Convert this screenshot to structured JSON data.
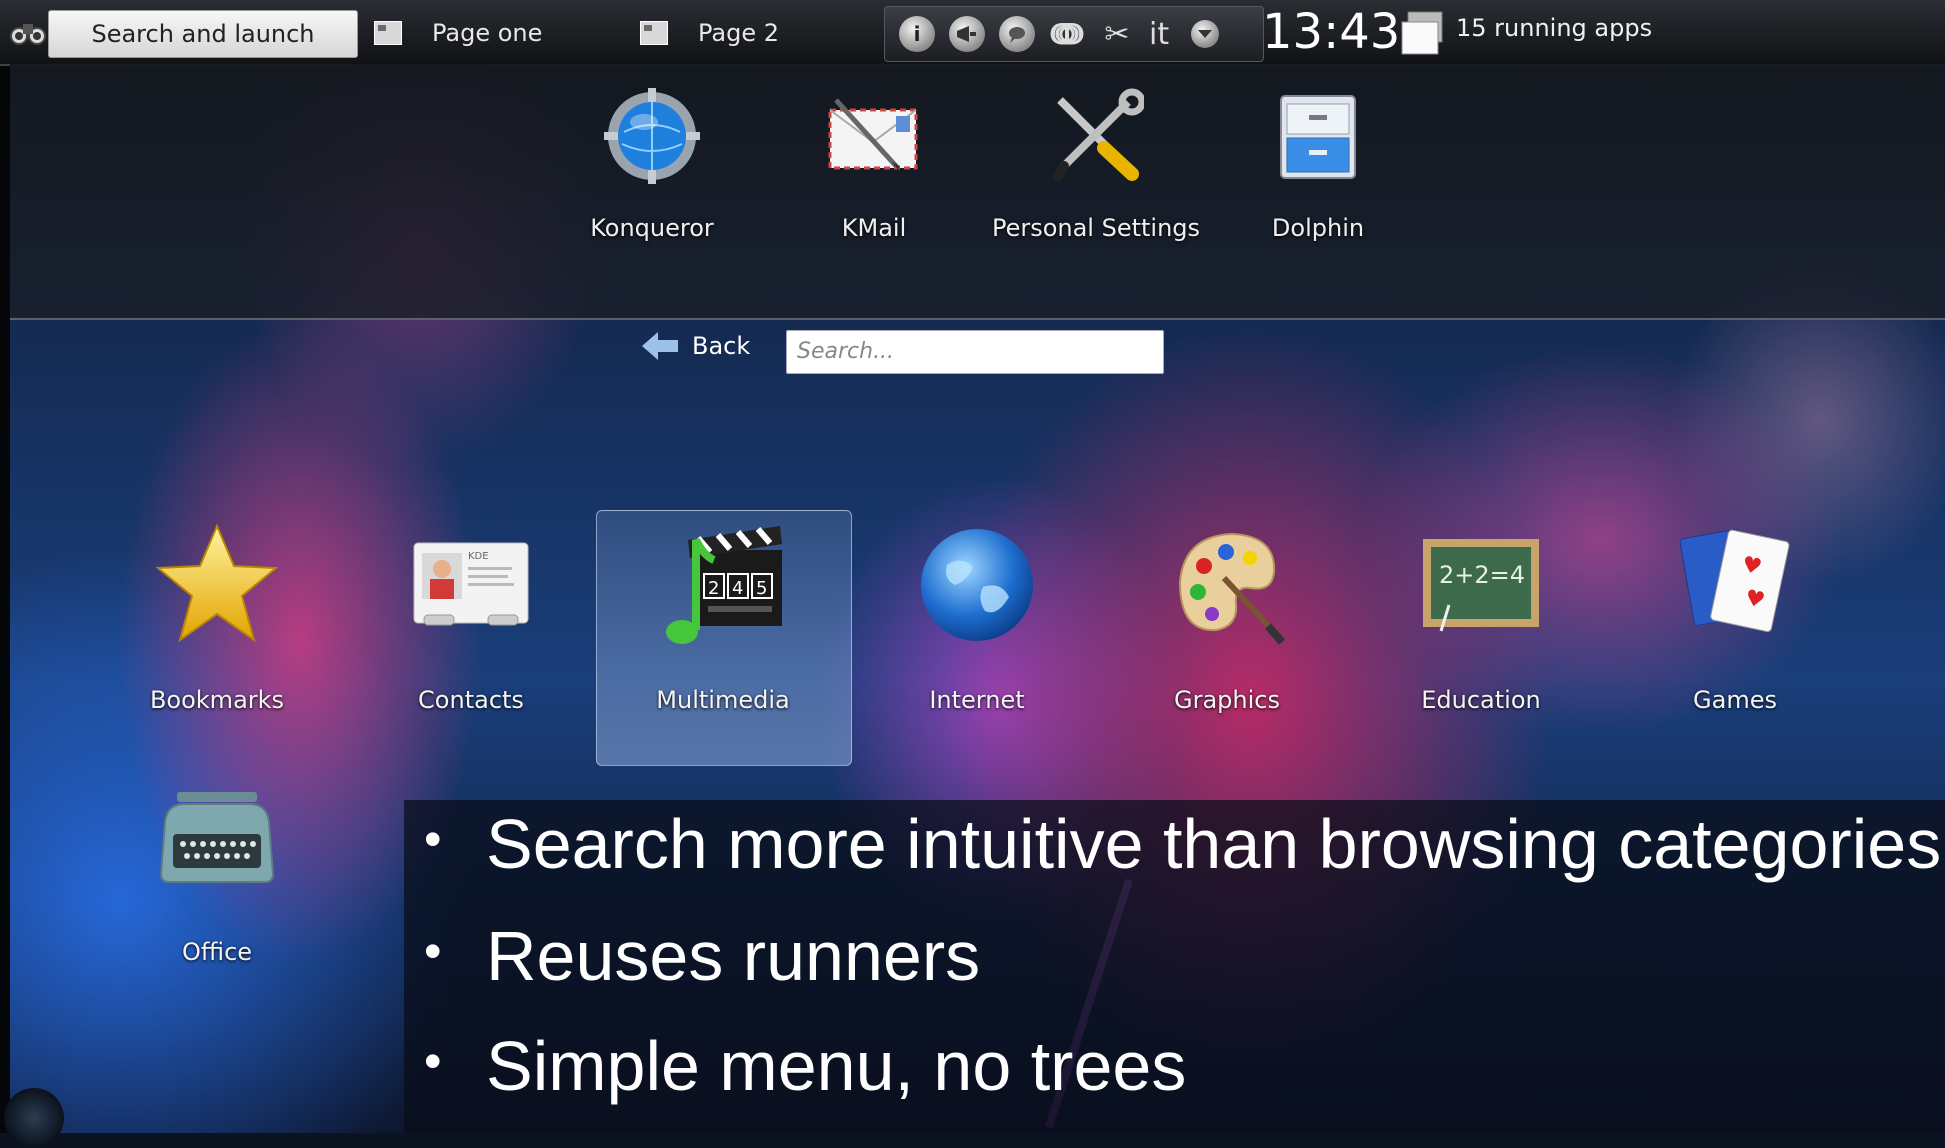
{
  "panel": {
    "launcher_label": "Search and launch",
    "pages": [
      {
        "label": "Page one"
      },
      {
        "label": "Page 2"
      }
    ],
    "tray": {
      "info_icon_char": "i",
      "keyboard_layout": "it"
    },
    "clock": "13:43",
    "running_apps": "15 running apps"
  },
  "favorites": [
    {
      "label": "Konqueror",
      "icon": "konqueror-globe-icon"
    },
    {
      "label": "KMail",
      "icon": "kmail-envelope-icon"
    },
    {
      "label": "Personal Settings",
      "icon": "settings-tools-icon"
    },
    {
      "label": "Dolphin",
      "icon": "dolphin-cabinet-icon"
    }
  ],
  "navigation": {
    "back_label": "Back",
    "search_placeholder": "Search..."
  },
  "categories": [
    {
      "label": "Bookmarks",
      "icon": "star-icon"
    },
    {
      "label": "Contacts",
      "icon": "contact-card-icon"
    },
    {
      "label": "Multimedia",
      "icon": "clapperboard-icon",
      "selected": true
    },
    {
      "label": "Internet",
      "icon": "globe-icon"
    },
    {
      "label": "Graphics",
      "icon": "palette-icon"
    },
    {
      "label": "Education",
      "icon": "chalkboard-icon"
    },
    {
      "label": "Games",
      "icon": "playing-cards-icon"
    },
    {
      "label": "Office",
      "icon": "typewriter-icon"
    }
  ],
  "icon_text": {
    "contact_card": "KDE",
    "clapperboard_digits": [
      "2",
      "4",
      "5"
    ],
    "chalkboard": "2+2=4"
  },
  "slide_bullets": [
    "Search more intuitive than browsing categories",
    "Reuses runners",
    "Simple menu, no trees"
  ]
}
